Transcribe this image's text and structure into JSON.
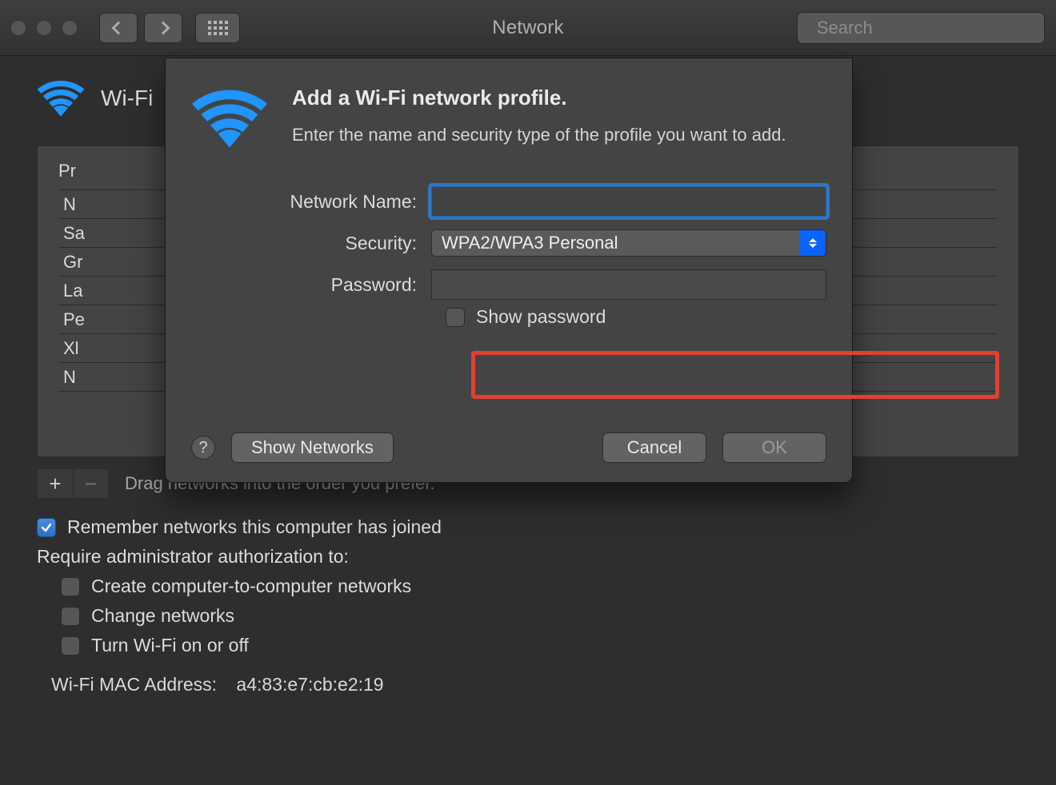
{
  "window": {
    "title": "Network"
  },
  "toolbar": {
    "search_placeholder": "Search"
  },
  "page": {
    "header_label": "Wi-Fi",
    "preferred_column_header": "Pr",
    "name_column_header": "N",
    "networks": [
      "Sa",
      "Gr",
      "La",
      "Pe",
      "Xl",
      "N"
    ],
    "drag_hint": "Drag networks into the order you prefer.",
    "remember_label": "Remember networks this computer has joined",
    "require_label": "Require administrator authorization to:",
    "opt_create": "Create computer-to-computer networks",
    "opt_change": "Change networks",
    "opt_turn": "Turn Wi-Fi on or off",
    "mac_label": "Wi-Fi MAC Address:",
    "mac_value": "a4:83:e7:cb:e2:19"
  },
  "dialog": {
    "heading": "Add a Wi-Fi network profile.",
    "subtext": "Enter the name and security type of the profile you want to add.",
    "network_name_label": "Network Name:",
    "network_name_value": "",
    "security_label": "Security:",
    "security_value": "WPA2/WPA3 Personal",
    "password_label": "Password:",
    "password_value": "",
    "show_password_label": "Show password",
    "show_networks_label": "Show Networks",
    "cancel_label": "Cancel",
    "ok_label": "OK"
  }
}
